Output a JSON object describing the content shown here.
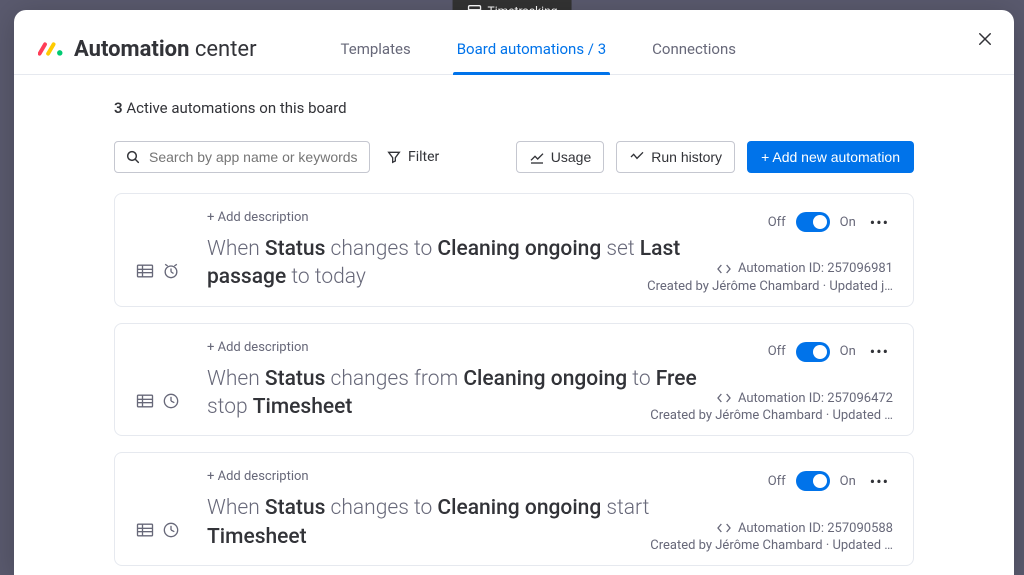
{
  "topPill": "Timetracking",
  "brand": {
    "bold": "Automation",
    "light": "center"
  },
  "tabs": {
    "templates": "Templates",
    "board_automations": "Board automations / 3",
    "connections": "Connections"
  },
  "summary": {
    "count": "3",
    "text": "Active automations on this board"
  },
  "toolbar": {
    "search_placeholder": "Search by app name or keywords",
    "filter": "Filter",
    "usage": "Usage",
    "run_history": "Run history",
    "add_new": "+ Add new automation"
  },
  "automations": [
    {
      "add_desc": "+ Add description",
      "rule_parts": [
        "When ",
        "Status",
        " changes to ",
        "Cleaning ongoing",
        " set ",
        "Last passage",
        " to today"
      ],
      "off": "Off",
      "on": "On",
      "id_label": "Automation ID: 257096981",
      "created": "Created by Jérôme Chambard · Updated j…",
      "icon2": "alarm"
    },
    {
      "add_desc": "+ Add description",
      "rule_parts": [
        "When ",
        "Status",
        " changes from ",
        "Cleaning ongoing",
        " to ",
        "Free",
        " stop ",
        "Timesheet"
      ],
      "off": "Off",
      "on": "On",
      "id_label": "Automation ID: 257096472",
      "created": "Created by Jérôme Chambard · Updated …",
      "icon2": "clock"
    },
    {
      "add_desc": "+ Add description",
      "rule_parts": [
        "When ",
        "Status",
        " changes to ",
        "Cleaning ongoing",
        " start ",
        "Timesheet"
      ],
      "off": "Off",
      "on": "On",
      "id_label": "Automation ID: 257090588",
      "created": "Created by Jérôme Chambard · Updated …",
      "icon2": "clock"
    }
  ]
}
